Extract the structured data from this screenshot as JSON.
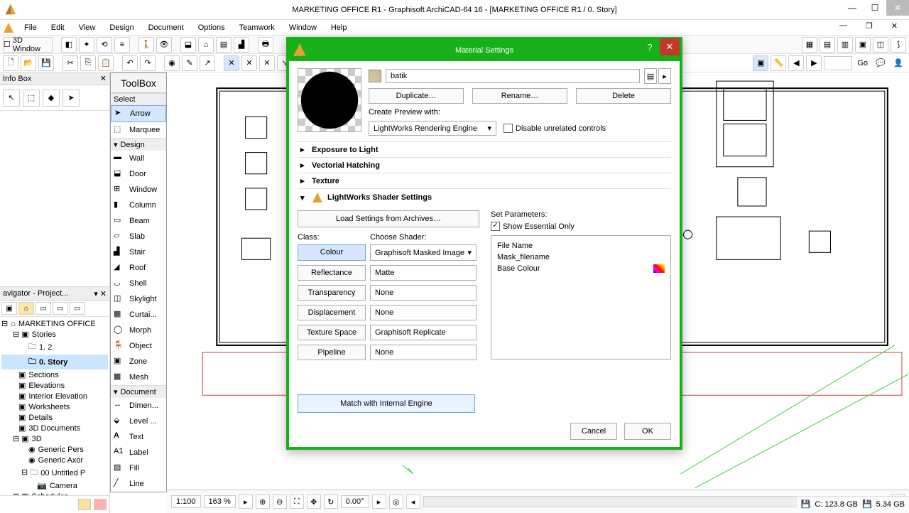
{
  "titlebar": {
    "text": "MARKETING OFFICE R1 - Graphisoft ArchiCAD-64 16 - [MARKETING OFFICE R1 / 0. Story]"
  },
  "menu": {
    "file": "File",
    "edit": "Edit",
    "view": "View",
    "design": "Design",
    "document": "Document",
    "options": "Options",
    "teamwork": "Teamwork",
    "window": "Window",
    "help": "Help"
  },
  "toolbar": {
    "threeD": "3D Window",
    "go": "Go"
  },
  "infobox": {
    "title": "Info Box"
  },
  "toolbox": {
    "title": "ToolBox",
    "sect_select": "Select",
    "sect_design": "Design",
    "sect_document": "Document",
    "arrow": "Arrow",
    "marquee": "Marquee",
    "wall": "Wall",
    "door": "Door",
    "window": "Window",
    "column": "Column",
    "beam": "Beam",
    "slab": "Slab",
    "stair": "Stair",
    "roof": "Roof",
    "shell": "Shell",
    "skylight": "Skylight",
    "curtain": "Curtai...",
    "morph": "Morph",
    "object": "Object",
    "zone": "Zone",
    "mesh": "Mesh",
    "dimen": "Dimen...",
    "level": "Level ...",
    "text": "Text",
    "label": "Label",
    "fill": "Fill",
    "line": "Line"
  },
  "navigator": {
    "title": "avigator - Project...",
    "root": "MARKETING OFFICE",
    "stories": "Stories",
    "s1": "1. 2",
    "s0": "0. Story",
    "sections": "Sections",
    "elevations": "Elevations",
    "interior": "Interior Elevation",
    "worksheets": "Worksheets",
    "details": "Details",
    "docs3d": "3D Documents",
    "threeD": "3D",
    "gp": "Generic Pers",
    "ga": "Generic Axor",
    "untitled": "00 Untitled P",
    "camera": "Camera",
    "schedules": "Schedules"
  },
  "status": {
    "scale": "1:100",
    "zoom": "163 %",
    "angle": "0.00°",
    "diskC": "C: 123.8 GB",
    "disk": "5.34 GB"
  },
  "dialog": {
    "title": "Material Settings",
    "material_name": "batik",
    "duplicate": "Duplicate…",
    "rename": "Rename…",
    "delete": "Delete",
    "create_preview": "Create Preview with:",
    "engine": "LightWorks Rendering Engine",
    "disable_unrelated": "Disable unrelated controls",
    "sect_exposure": "Exposure to Light",
    "sect_hatching": "Vectorial Hatching",
    "sect_texture": "Texture",
    "sect_shader": "LightWorks Shader Settings",
    "load_settings": "Load Settings from Archives…",
    "class_label": "Class:",
    "choose_label": "Choose Shader:",
    "classes": {
      "colour": "Colour",
      "reflectance": "Reflectance",
      "transparency": "Transparency",
      "displacement": "Displacement",
      "texture_space": "Texture Space",
      "pipeline": "Pipeline"
    },
    "shaders": {
      "colour": "Graphisoft Masked Image",
      "reflectance": "Matte",
      "transparency": "None",
      "displacement": "None",
      "texture_space": "Graphisoft Replicate",
      "pipeline": "None"
    },
    "match": "Match with Internal Engine",
    "set_params": "Set Parameters:",
    "show_essential": "Show Essential Only",
    "params": {
      "file": "File Name",
      "mask": "Mask_filename",
      "base": "Base Colour"
    },
    "cancel": "Cancel",
    "ok": "OK"
  }
}
